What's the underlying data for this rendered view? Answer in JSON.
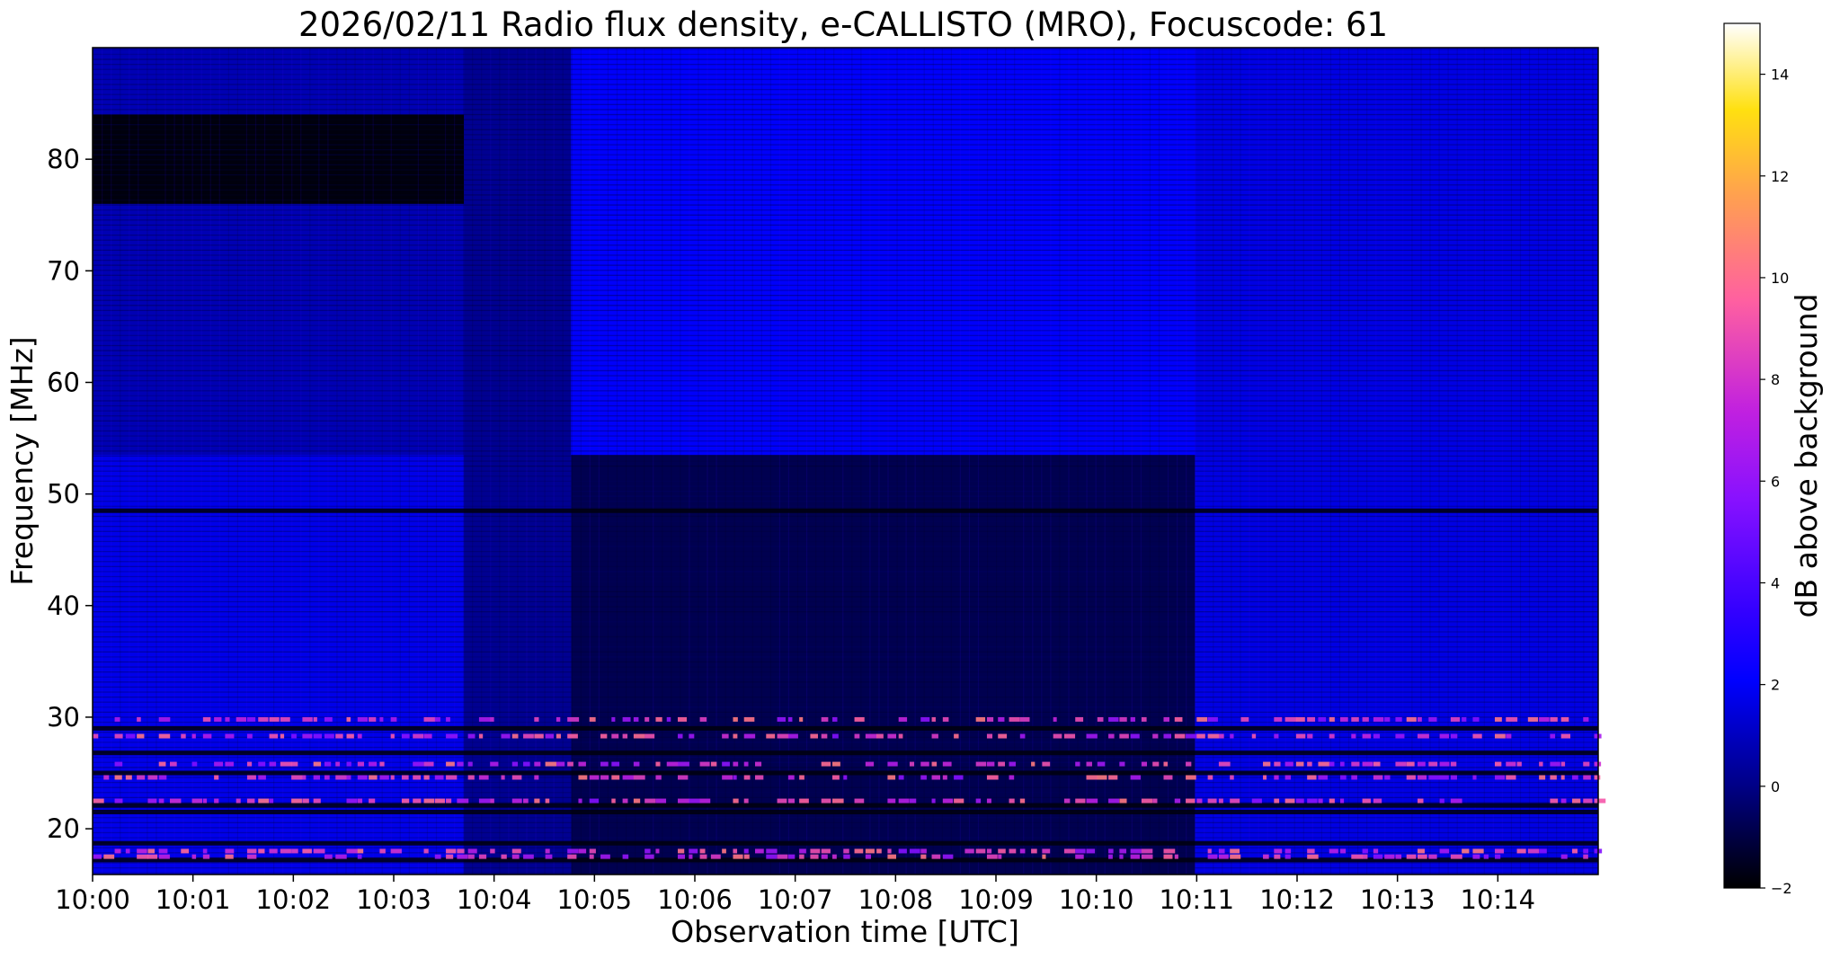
{
  "chart_data": {
    "type": "heatmap",
    "title": "2026/02/11  Radio flux density, e-CALLISTO (MRO), Focuscode: 61",
    "xlabel": "Observation time [UTC]",
    "ylabel": "Frequency [MHz]",
    "colorbar_label": "dB above background",
    "colormap": "gnuplot2",
    "xlim_minutes": [
      0,
      15
    ],
    "x_tick_labels": [
      "10:00",
      "10:01",
      "10:02",
      "10:03",
      "10:04",
      "10:05",
      "10:06",
      "10:07",
      "10:08",
      "10:09",
      "10:10",
      "10:11",
      "10:12",
      "10:13",
      "10:14"
    ],
    "ylim": [
      15.9,
      90.0
    ],
    "y_ticks": [
      "20",
      "30",
      "40",
      "50",
      "60",
      "70",
      "80"
    ],
    "clim": [
      -2,
      15
    ],
    "colorbar_ticks": [
      "−2",
      "0",
      "2",
      "4",
      "6",
      "8",
      "10",
      "12",
      "14"
    ],
    "background_level_db": 1.5,
    "time_segments": [
      {
        "start": "10:00:00",
        "end": "10:03:42",
        "mean_db": 1.7,
        "low_band_mhz": [
          15.9,
          53.5
        ],
        "high_band_mhz": [
          53.5,
          90
        ],
        "high_band_db": 0.3,
        "quiet_block_mhz": [
          76,
          84
        ],
        "quiet_block_db": -1.8
      },
      {
        "start": "10:03:42",
        "end": "10:04:46",
        "mean_db": 0.2,
        "note": "gap / reduced signal"
      },
      {
        "start": "10:04:46",
        "end": "10:10:59",
        "mean_db": 2.0,
        "low_band_mhz": [
          15.9,
          53.5
        ],
        "low_band_db": -0.8
      },
      {
        "start": "10:10:59",
        "end": "10:15:00",
        "mean_db": 1.6
      }
    ],
    "dark_channels_mhz": [
      17.2,
      18.7,
      21.5,
      22.1,
      25.0,
      26.8,
      29.0,
      48.5
    ],
    "rfi_channels_mhz": [
      17.5,
      18.0,
      22.5,
      24.6,
      25.8,
      28.3,
      29.8
    ],
    "rfi_peak_db": 9
  }
}
